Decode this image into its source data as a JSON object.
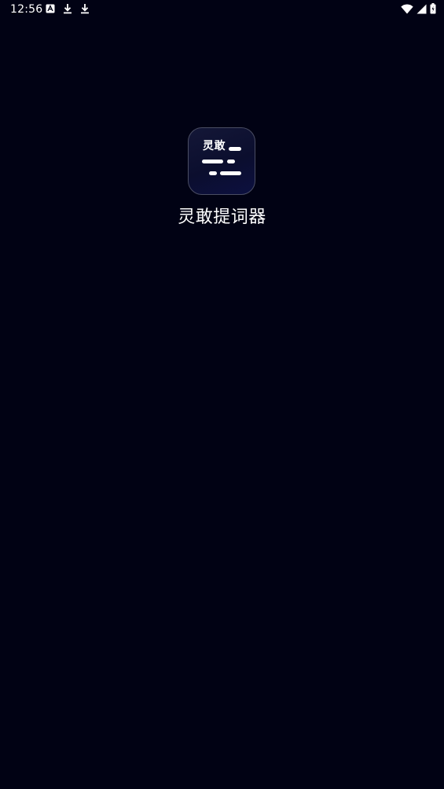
{
  "status_bar": {
    "time": "12:56",
    "notification_icons": [
      "text-notification-icon",
      "download-icon",
      "download-icon"
    ],
    "system_icons": [
      "wifi-icon",
      "cellular-signal-icon",
      "battery-icon"
    ]
  },
  "splash": {
    "icon_label": "灵敢",
    "app_name": "灵敢提词器"
  },
  "colors": {
    "background": "#010214",
    "icon_border": "#4a4d63",
    "icon_fill": "#0b0e2e",
    "text": "#ffffff"
  }
}
